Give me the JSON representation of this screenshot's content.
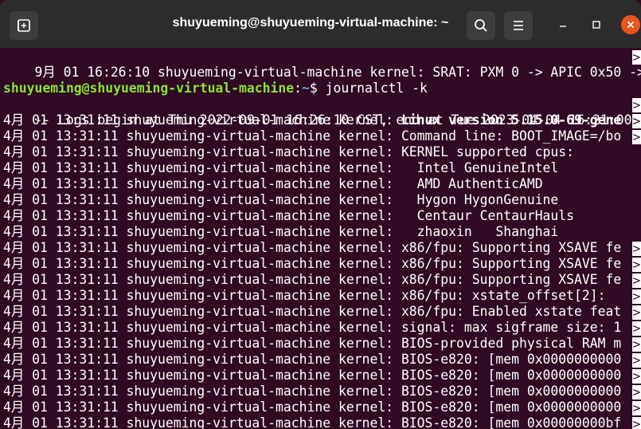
{
  "window": {
    "title": "shuyueming@shuyueming-virtual-machine: ~",
    "new_tab_icon": "new-tab-icon",
    "search_icon": "search-icon",
    "menu_icon": "hamburger-menu-icon",
    "minimize_icon": "minimize-icon",
    "maximize_icon": "maximize-icon",
    "close_icon": "close-icon",
    "close_color": "#e95420"
  },
  "terminal": {
    "background": "#300a24",
    "trunc_marker": ">",
    "top_line": "9月 01 16:26:10 shuyueming-virtual-machine kernel: SRAT: PXM 0 -> APIC 0x50 -> ",
    "prompt": {
      "user_host": "shuyueming@shuyueming-virtual-machine",
      "separator": ":",
      "path": "~",
      "dollar": "$ ",
      "command": "journalctl -k"
    },
    "logs_begin": "-- Logs begin at Thu 2022-09-01 16:26:10 CST, end at Tue 2023-04-04 16:21:00 CS",
    "prefix": "4月 01 13:31:11 shuyueming-virtual-machine kernel: ",
    "entries": [
      {
        "msg": "Linux version 5.15.0-69-gene",
        "bold": true,
        "trunc": true
      },
      {
        "msg": "Command line: BOOT_IMAGE=/bo",
        "bold": false,
        "trunc": true
      },
      {
        "msg": "KERNEL supported cpus:",
        "bold": false,
        "trunc": false
      },
      {
        "msg": "  Intel GenuineIntel",
        "bold": false,
        "trunc": false
      },
      {
        "msg": "  AMD AuthenticAMD",
        "bold": false,
        "trunc": false
      },
      {
        "msg": "  Hygon HygonGenuine",
        "bold": false,
        "trunc": false
      },
      {
        "msg": "  Centaur CentaurHauls",
        "bold": false,
        "trunc": false
      },
      {
        "msg": "  zhaoxin   Shanghai",
        "bold": false,
        "trunc": false
      },
      {
        "msg": "x86/fpu: Supporting XSAVE fe",
        "bold": false,
        "trunc": true
      },
      {
        "msg": "x86/fpu: Supporting XSAVE fe",
        "bold": false,
        "trunc": true
      },
      {
        "msg": "x86/fpu: Supporting XSAVE fe",
        "bold": false,
        "trunc": true
      },
      {
        "msg": "x86/fpu: xstate_offset[2]:  ",
        "bold": false,
        "trunc": true
      },
      {
        "msg": "x86/fpu: Enabled xstate feat",
        "bold": false,
        "trunc": true
      },
      {
        "msg": "signal: max sigframe size: 1",
        "bold": false,
        "trunc": true
      },
      {
        "msg": "BIOS-provided physical RAM m",
        "bold": false,
        "trunc": true
      },
      {
        "msg": "BIOS-e820: [mem 0x0000000000",
        "bold": false,
        "trunc": true
      },
      {
        "msg": "BIOS-e820: [mem 0x0000000000",
        "bold": false,
        "trunc": true
      },
      {
        "msg": "BIOS-e820: [mem 0x0000000000",
        "bold": false,
        "trunc": true
      },
      {
        "msg": "BIOS-e820: [mem 0x0000000000",
        "bold": false,
        "trunc": true
      },
      {
        "msg": "BIOS-e820: [mem 0x00000000bf",
        "bold": false,
        "trunc": true
      }
    ]
  }
}
